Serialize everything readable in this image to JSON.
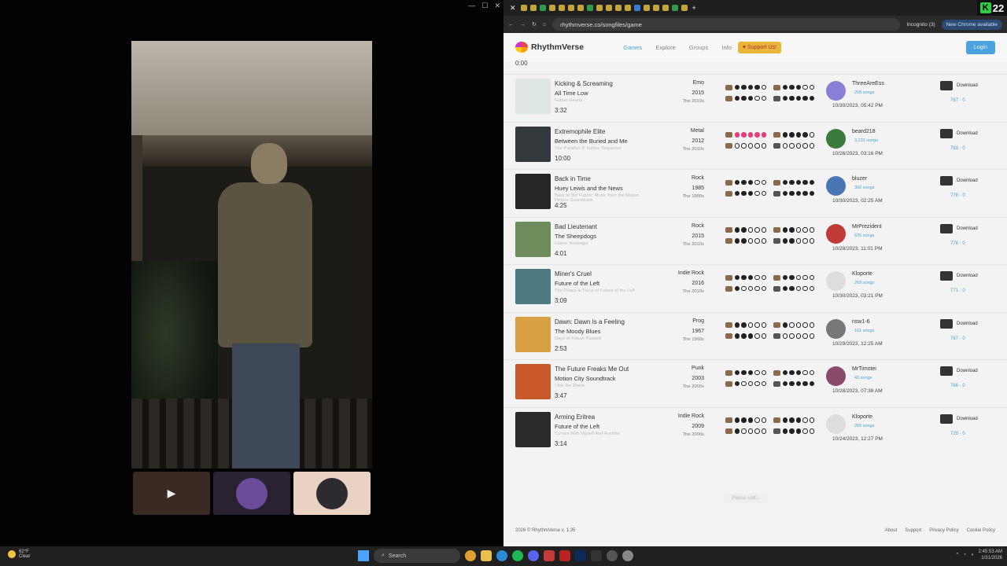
{
  "browser": {
    "url": "rhythmverse.co/songfiles/game",
    "incognito": "Incognito (3)",
    "chrome_update": "New Chrome available",
    "badge_k": "K",
    "badge_number": "22"
  },
  "site": {
    "name": "RhythmVerse",
    "nav": [
      "Games",
      "Explore",
      "Groups",
      "Info"
    ],
    "support": "Support Us!",
    "login": "Login",
    "partial_length": "0:00",
    "loading": "Please wait...",
    "footer": {
      "copyright": "2026 © RhythmVerse v. 1.35",
      "links": [
        "About",
        "Support",
        "Privacy Policy",
        "Cookie Policy"
      ]
    }
  },
  "songs": [
    {
      "title": "Kicking & Screaming",
      "artist": "All Time Low",
      "album": "Future Hearts",
      "length": "3:32",
      "genre": "Emo",
      "year": "2015",
      "decade": "The 2010s",
      "uploader": "ThreeAreEss",
      "count": "208 songs",
      "date": "10/30/2023, 05:42 PM",
      "stats": "767 · 0",
      "cover": "#dfe7e5",
      "avatar": "#8a7fd6"
    },
    {
      "title": "Extremophile Elite",
      "artist": "Between the Buried and Me",
      "album": "The Parallax II: Future Sequence",
      "length": "10:00",
      "genre": "Metal",
      "year": "2012",
      "decade": "The 2010s",
      "uploader": "beard218",
      "count": "3,231 songs",
      "date": "10/26/2023, 03:16 PM",
      "stats": "783 · 0",
      "cover": "#34393d",
      "avatar": "#3b7b3b"
    },
    {
      "title": "Back in Time",
      "artist": "Huey Lewis and the News",
      "album": "Back to the Future: Music from the Motion Picture Soundtrack",
      "length": "4:25",
      "genre": "Rock",
      "year": "1985",
      "decade": "The 1980s",
      "uploader": "bluzer",
      "count": "302 songs",
      "date": "10/30/2023, 02:25 AM",
      "stats": "778 · 0",
      "cover": "#262626",
      "avatar": "#4a77b4"
    },
    {
      "title": "Bad Lieutenant",
      "artist": "The Sheepdogs",
      "album": "Future Nostalgia",
      "length": "4:01",
      "genre": "Rock",
      "year": "2015",
      "decade": "The 2010s",
      "uploader": "MrPrezident",
      "count": "635 songs",
      "date": "10/28/2023, 11:01 PM",
      "stats": "778 · 0",
      "cover": "#6c8c5a",
      "avatar": "#c03a3a"
    },
    {
      "title": "Miner's Cruel",
      "artist": "Future of the Left",
      "album": "The Peace & Truce of Future of the Left",
      "length": "3:09",
      "genre": "Indie Rock",
      "year": "2016",
      "decade": "The 2010s",
      "uploader": "Kloporte",
      "count": "269 songs",
      "date": "10/30/2023, 03:21 PM",
      "stats": "771 · 0",
      "cover": "#4d7a80",
      "avatar": "#ddd"
    },
    {
      "title": "Dawn: Dawn Is a Feeling",
      "artist": "The Moody Blues",
      "album": "Days of Future Passed",
      "length": "2:53",
      "genre": "Prog",
      "year": "1967",
      "decade": "The 1960s",
      "uploader": "nsw1-6",
      "count": "161 songs",
      "date": "10/29/2023, 12:25 AM",
      "stats": "767 · 0",
      "cover": "#d9a043",
      "avatar": "#777"
    },
    {
      "title": "The Future Freaks Me Out",
      "artist": "Motion City Soundtrack",
      "album": "I Am the Movie",
      "length": "3:47",
      "genre": "Punk",
      "year": "2003",
      "decade": "The 2000s",
      "uploader": "MrTimotei",
      "count": "43 songs",
      "date": "10/28/2023, 07:38 AM",
      "stats": "766 · 0",
      "cover": "#c9582a",
      "avatar": "#8a4a6a"
    },
    {
      "title": "Arming Eritrea",
      "artist": "Future of the Left",
      "album": "Curses With Myself And Another",
      "length": "3:14",
      "genre": "Indie Rock",
      "year": "2009",
      "decade": "The 2000s",
      "uploader": "Kloporte",
      "count": "269 songs",
      "date": "10/24/2023, 12:27 PM",
      "stats": "720 · 0",
      "cover": "#2a2a2a",
      "avatar": "#ddd"
    }
  ],
  "download_label": "Download",
  "taskbar": {
    "temp": "62°F",
    "cond": "Clear",
    "search": "Search",
    "time": "2:45:53 AM",
    "date": "1/31/2026"
  }
}
